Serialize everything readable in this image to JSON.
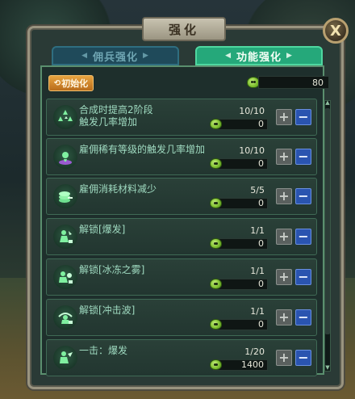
{
  "window": {
    "title": "强化",
    "close_label": "X"
  },
  "tabs": [
    {
      "label": "佣兵强化",
      "active": false
    },
    {
      "label": "功能强化",
      "active": true
    }
  ],
  "reset_button": {
    "label": "初始化"
  },
  "total": {
    "value": "80",
    "icon": "slime-icon"
  },
  "rows": [
    {
      "name": "合成时提高2阶段\n触发几率增加",
      "level": "10/10",
      "cost": "0",
      "icon": "rune-trio-icon"
    },
    {
      "name": "雇佣稀有等级的触发几率增加",
      "level": "10/10",
      "cost": "0",
      "icon": "summon-pad-icon"
    },
    {
      "name": "雇佣消耗材料减少",
      "level": "5/5",
      "cost": "0",
      "icon": "coin-stack-icon"
    },
    {
      "name": "解锁[爆发]",
      "level": "1/1",
      "cost": "0",
      "icon": "burst-unlock-icon"
    },
    {
      "name": "解锁[冰冻之雾]",
      "level": "1/1",
      "cost": "0",
      "icon": "freeze-mist-unlock-icon"
    },
    {
      "name": "解锁[冲击波]",
      "level": "1/1",
      "cost": "0",
      "icon": "shockwave-unlock-icon"
    },
    {
      "name": "一击：爆发",
      "level": "1/20",
      "cost": "1400",
      "icon": "one-hit-burst-icon"
    }
  ],
  "buttons": {
    "plus": "+",
    "minus": "−"
  },
  "colors": {
    "accent_green": "#25a87a",
    "minus_blue": "#2a54b0",
    "reset_orange": "#e8a440"
  }
}
